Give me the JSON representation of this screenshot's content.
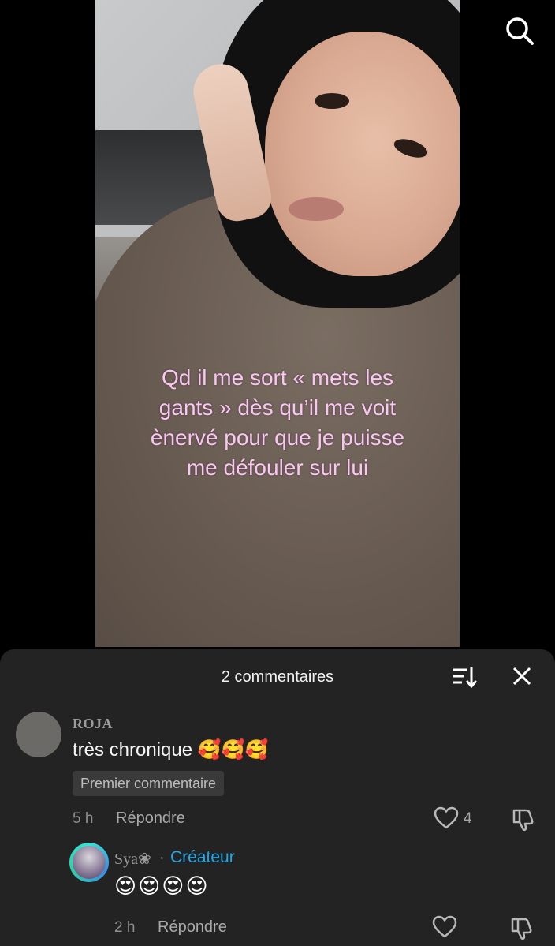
{
  "video": {
    "caption_lines": [
      "Qd il me sort « mets les",
      "gants » dès qu’il me voit",
      "ènervé pour que je puisse",
      "me défouler sur lui"
    ]
  },
  "top_bar": {
    "search_icon": "search-icon"
  },
  "comments_sheet": {
    "title": "2 commentaires",
    "sort_icon": "sort-icon",
    "close_icon": "close-icon",
    "comments": [
      {
        "author": "ROJA",
        "text": "très chronique 🥰🥰🥰",
        "badge": "Premier commentaire",
        "time": "5 h",
        "reply_label": "Répondre",
        "likes": "4"
      }
    ],
    "replies": [
      {
        "author": "Sya❀",
        "separator": "·",
        "role": "Créateur",
        "text": "😍😍😍😍",
        "time": "2 h",
        "reply_label": "Répondre"
      }
    ]
  },
  "colors": {
    "caption": "#f7c9ee",
    "sheet_bg": "#232323",
    "creator": "#25a7e6"
  }
}
